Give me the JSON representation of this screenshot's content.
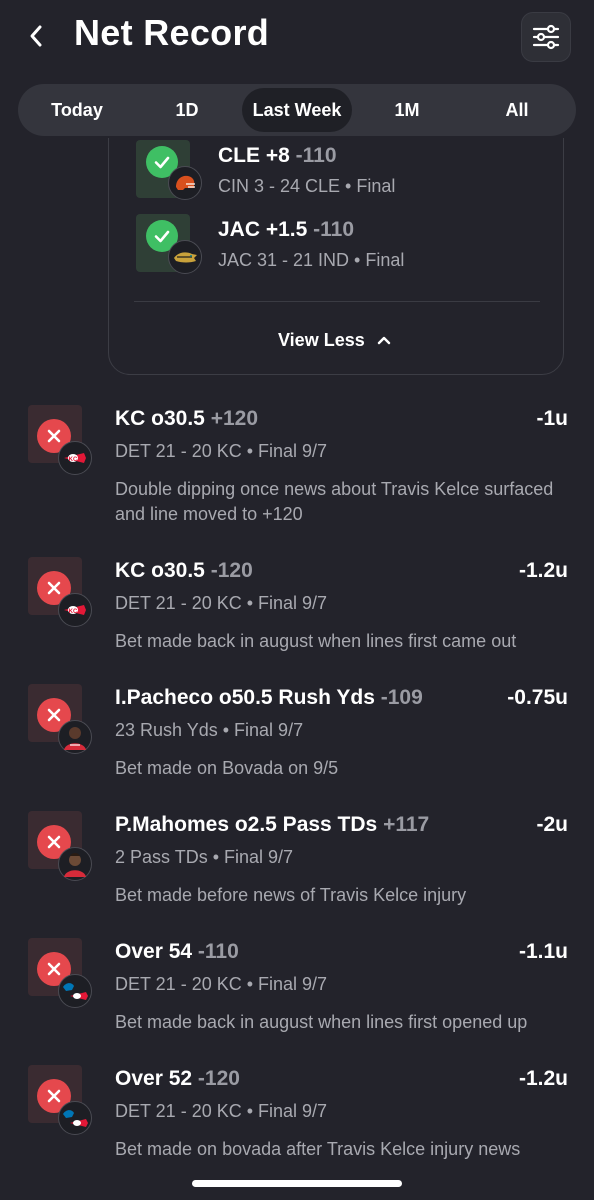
{
  "header": {
    "title": "Net Record"
  },
  "segments": [
    {
      "label": "Today",
      "active": false
    },
    {
      "label": "1D",
      "active": false
    },
    {
      "label": "Last Week",
      "active": true
    },
    {
      "label": "1M",
      "active": false
    },
    {
      "label": "All",
      "active": false
    }
  ],
  "card": {
    "rows": [
      {
        "pick": "CLE +8",
        "odds": "-110",
        "detail": "CIN 3 - 24 CLE • Final",
        "team_logo": "browns-helmet-icon"
      },
      {
        "pick": "JAC +1.5",
        "odds": "-110",
        "detail": "JAC 31 - 21 IND • Final",
        "team_logo": "jaguars-logo-icon"
      }
    ],
    "view_less": "View Less"
  },
  "bets": [
    {
      "pick": "KC o30.5",
      "odds": "+120",
      "units": "-1u",
      "detail": "DET 21 - 20 KC • Final 9/7",
      "note": "Double dipping once news about Travis Kelce surfaced and line moved to +120",
      "logo": "chiefs-logo-icon"
    },
    {
      "pick": "KC o30.5",
      "odds": "-120",
      "units": "-1.2u",
      "detail": "DET 21 - 20 KC • Final 9/7",
      "note": "Bet made back in august when lines first came out",
      "logo": "chiefs-logo-icon"
    },
    {
      "pick": "I.Pacheco o50.5 Rush Yds",
      "odds": "-109",
      "units": "-0.75u",
      "detail": "23 Rush Yds • Final 9/7",
      "note": "Bet made on Bovada on 9/5",
      "logo": "player-headshot-icon"
    },
    {
      "pick": "P.Mahomes o2.5 Pass TDs",
      "odds": "+117",
      "units": "-2u",
      "detail": "2 Pass TDs • Final 9/7",
      "note": "Bet made before news of Travis Kelce injury",
      "logo": "player-headshot-icon"
    },
    {
      "pick": "Over 54",
      "odds": "-110",
      "units": "-1.1u",
      "detail": "DET 21 - 20 KC • Final 9/7",
      "note": "Bet made back in august when lines first opened up",
      "logo": "lions-chiefs-logo-icon"
    },
    {
      "pick": "Over 52",
      "odds": "-120",
      "units": "-1.2u",
      "detail": "DET 21 - 20 KC • Final 9/7",
      "note": "Bet made on bovada after Travis Kelce injury news",
      "logo": "lions-chiefs-logo-icon"
    }
  ],
  "colors": {
    "background": "#23232b",
    "win": "#3fbf64",
    "loss": "#e5484d",
    "muted": "#a8a9b0"
  }
}
